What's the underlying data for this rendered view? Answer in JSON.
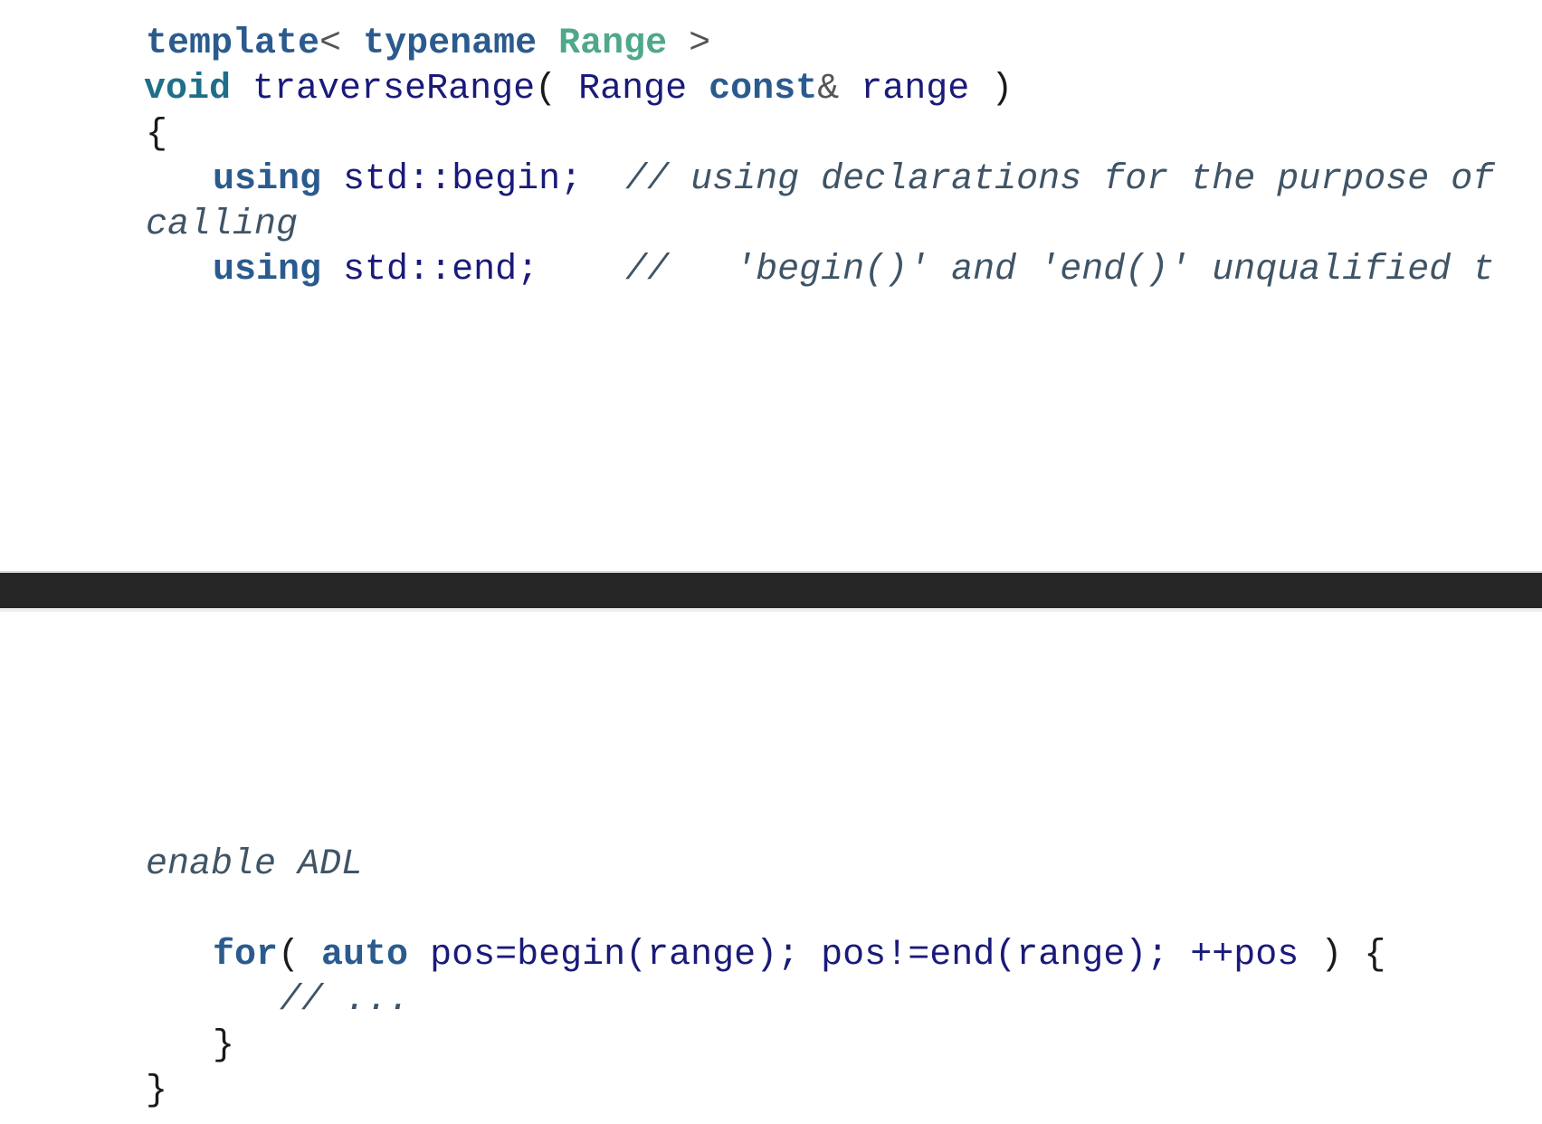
{
  "code_top": {
    "line1": {
      "template": "template",
      "lt": "<",
      "typename": "typename",
      "range_type": "Range",
      "gt": ">"
    },
    "line2": {
      "void": "void",
      "fn": "traverseRange",
      "open": "(",
      "range_type": "Range",
      "const": "const",
      "amp": "&",
      "param": "range",
      "close": ")"
    },
    "line3": {
      "brace": "{"
    },
    "line4": {
      "using": "using",
      "decl": "std::begin;",
      "comment": "// using declarations for the purpose of"
    },
    "line5": {
      "comment_cont": "calling"
    },
    "line6": {
      "using": "using",
      "decl": "std::end;",
      "comment": "//   'begin()' and 'end()' unqualified t"
    }
  },
  "code_bottom": {
    "line1": {
      "comment_cont": "enable ADL"
    },
    "line2": {
      "for": "for",
      "open": "(",
      "auto": "auto",
      "init": "pos=begin(range);",
      "cond": "pos!=end(range);",
      "incr": "++pos",
      "close": ")",
      "brace": "{"
    },
    "line3": {
      "comment": "// ..."
    },
    "line4": {
      "brace": "}"
    },
    "line5": {
      "brace": "}"
    }
  }
}
